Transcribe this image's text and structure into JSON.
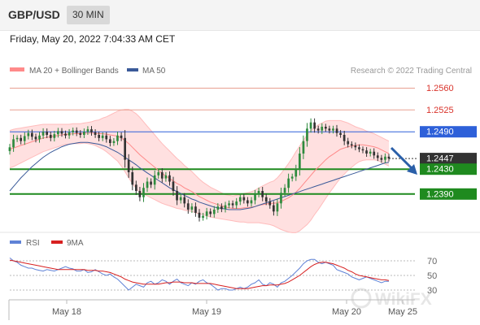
{
  "header": {
    "pair": "GBP/USD",
    "timeframe": "30 MIN",
    "datetime": "Friday, May 20, 2022 7:04:33 AM CET"
  },
  "legend": {
    "ma20": "MA 20 + Bollinger Bands",
    "ma50": "MA 50",
    "credit": "Research © 2022 Trading Central"
  },
  "rsi_legend": {
    "rsi": "RSI",
    "ma": "9MA"
  },
  "watermark": "WikiFX",
  "colors": {
    "up": "#2e8b3e",
    "down": "#333333",
    "bands": "#ff8a8a",
    "ma50": "#3a5a99",
    "rsi": "#5f82d6",
    "rsi_ma": "#d72020",
    "resistance": "#e8a090",
    "pivot_line": "#2e60d9",
    "support": "#1f8a1f",
    "current": "#333333"
  },
  "chart_data": [
    {
      "type": "candlestick",
      "title": "GBP/USD",
      "x_labels": [
        "May 18",
        "May 19",
        "May 20",
        "May 25"
      ],
      "ylim": [
        1.2335,
        1.2575
      ],
      "levels": [
        {
          "label": "1.2560",
          "value": 1.256,
          "kind": "resistance"
        },
        {
          "label": "1.2525",
          "value": 1.2525,
          "kind": "resistance"
        },
        {
          "label": "1.2490",
          "value": 1.249,
          "kind": "pivot"
        },
        {
          "label": "1.2447",
          "value": 1.2447,
          "kind": "current"
        },
        {
          "label": "1.2430",
          "value": 1.243,
          "kind": "support"
        },
        {
          "label": "1.2390",
          "value": 1.239,
          "kind": "support"
        }
      ],
      "close": [
        1.2465,
        1.2478,
        1.248,
        1.2475,
        1.2483,
        1.2488,
        1.2482,
        1.2478,
        1.2484,
        1.249,
        1.2485,
        1.248,
        1.2486,
        1.2491,
        1.2487,
        1.2484,
        1.2489,
        1.2492,
        1.2488,
        1.2485,
        1.249,
        1.2494,
        1.2489,
        1.2485,
        1.248,
        1.2484,
        1.2478,
        1.2472,
        1.2475,
        1.2484,
        1.248,
        1.2445,
        1.2425,
        1.2405,
        1.2395,
        1.2385,
        1.24,
        1.241,
        1.2405,
        1.242,
        1.2425,
        1.2415,
        1.242,
        1.241,
        1.2395,
        1.238,
        1.2385,
        1.2375,
        1.2365,
        1.237,
        1.236,
        1.2352,
        1.2355,
        1.2362,
        1.2358,
        1.2365,
        1.237,
        1.2366,
        1.2372,
        1.2375,
        1.2372,
        1.2378,
        1.2385,
        1.238,
        1.2375,
        1.238,
        1.239,
        1.2395,
        1.2385,
        1.2378,
        1.2372,
        1.2362,
        1.2375,
        1.2392,
        1.24,
        1.2415,
        1.2418,
        1.243,
        1.2455,
        1.2475,
        1.2495,
        1.2505,
        1.2495,
        1.2492,
        1.2498,
        1.2495,
        1.2492,
        1.2495,
        1.2488,
        1.2485,
        1.2475,
        1.247,
        1.2468,
        1.2465,
        1.2462,
        1.246,
        1.2455,
        1.2458,
        1.2452,
        1.2448,
        1.2445,
        1.245,
        1.2447
      ],
      "ma20": [
        1.2462,
        1.2464,
        1.2466,
        1.2468,
        1.247,
        1.2472,
        1.2474,
        1.2476,
        1.2478,
        1.248,
        1.2481,
        1.2482,
        1.2483,
        1.2484,
        1.2485,
        1.2486,
        1.2486,
        1.2487,
        1.2487,
        1.2487,
        1.2488,
        1.2488,
        1.2488,
        1.2488,
        1.2487,
        1.2487,
        1.2486,
        1.2485,
        1.2484,
        1.2483,
        1.248,
        1.2476,
        1.2471,
        1.2465,
        1.2459,
        1.2453,
        1.2448,
        1.2443,
        1.2438,
        1.2433,
        1.2428,
        1.2423,
        1.2419,
        1.2415,
        1.2411,
        1.2407,
        1.2404,
        1.24,
        1.2397,
        1.2394,
        1.239,
        1.2386,
        1.2383,
        1.238,
        1.2377,
        1.2375,
        1.2373,
        1.2371,
        1.2369,
        1.2368,
        1.2367,
        1.2367,
        1.2367,
        1.2368,
        1.2368,
        1.2369,
        1.237,
        1.2372,
        1.2373,
        1.2374,
        1.2375,
        1.2375,
        1.2376,
        1.2378,
        1.2381,
        1.2384,
        1.2388,
        1.2393,
        1.2399,
        1.2406,
        1.2413,
        1.242,
        1.2427,
        1.2433,
        1.2439,
        1.2445,
        1.245,
        1.2454,
        1.2458,
        1.2462,
        1.2464,
        1.2466,
        1.2467,
        1.2468,
        1.2469,
        1.2469,
        1.2468,
        1.2467,
        1.2466,
        1.2464,
        1.2461,
        1.2458,
        1.2455
      ],
      "bollinger_width": [
        0.003,
        0.003,
        0.0029,
        0.0028,
        0.0027,
        0.0026,
        0.0025,
        0.0024,
        0.0023,
        0.0022,
        0.0021,
        0.002,
        0.0019,
        0.0018,
        0.0017,
        0.0016,
        0.0016,
        0.0016,
        0.0016,
        0.0016,
        0.0016,
        0.0017,
        0.0018,
        0.002,
        0.0022,
        0.0025,
        0.0028,
        0.0032,
        0.0036,
        0.004,
        0.0045,
        0.005,
        0.0055,
        0.0058,
        0.006,
        0.006,
        0.0058,
        0.0056,
        0.0054,
        0.0052,
        0.005,
        0.0048,
        0.0046,
        0.0044,
        0.0042,
        0.004,
        0.0038,
        0.0036,
        0.0034,
        0.0032,
        0.003,
        0.0028,
        0.0026,
        0.0025,
        0.0024,
        0.0023,
        0.0022,
        0.0021,
        0.002,
        0.002,
        0.002,
        0.0021,
        0.0022,
        0.0023,
        0.0024,
        0.0025,
        0.0026,
        0.0028,
        0.003,
        0.0032,
        0.0034,
        0.0036,
        0.004,
        0.0045,
        0.005,
        0.0055,
        0.006,
        0.0065,
        0.0068,
        0.007,
        0.0072,
        0.0072,
        0.007,
        0.0068,
        0.0065,
        0.0062,
        0.0058,
        0.0054,
        0.005,
        0.0046,
        0.0042,
        0.0038,
        0.0034,
        0.003,
        0.0027,
        0.0025,
        0.0023,
        0.0022,
        0.0021,
        0.002,
        0.002,
        0.002,
        0.002
      ],
      "ma50": [
        1.2395,
        1.2402,
        1.2409,
        1.2416,
        1.2422,
        1.2428,
        1.2434,
        1.2439,
        1.2444,
        1.2449,
        1.2453,
        1.2457,
        1.246,
        1.2463,
        1.2466,
        1.2468,
        1.247,
        1.2471,
        1.2472,
        1.2473,
        1.2473,
        1.2473,
        1.2472,
        1.2471,
        1.247,
        1.2468,
        1.2466,
        1.2463,
        1.246,
        1.2457,
        1.2453,
        1.2449,
        1.2445,
        1.2441,
        1.2437,
        1.2432,
        1.2428,
        1.2424,
        1.242,
        1.2416,
        1.2412,
        1.2408,
        1.2404,
        1.24,
        1.2397,
        1.2394,
        1.2391,
        1.2388,
        1.2385,
        1.2382,
        1.238,
        1.2377,
        1.2375,
        1.2373,
        1.2371,
        1.2369,
        1.2368,
        1.2367,
        1.2366,
        1.2365,
        1.2365,
        1.2365,
        1.2365,
        1.2366,
        1.2367,
        1.2368,
        1.237,
        1.2372,
        1.2374,
        1.2376,
        1.2378,
        1.238,
        1.2382,
        1.2384,
        1.2386,
        1.2388,
        1.239,
        1.2392,
        1.2394,
        1.2396,
        1.2398,
        1.24,
        1.2402,
        1.2404,
        1.2406,
        1.2408,
        1.241,
        1.2412,
        1.2414,
        1.2416,
        1.2418,
        1.242,
        1.2422,
        1.2424,
        1.2426,
        1.2428,
        1.243,
        1.2432,
        1.2434,
        1.2436,
        1.2438,
        1.244,
        1.2441
      ]
    },
    {
      "type": "line",
      "title": "RSI",
      "ylim": [
        20,
        80
      ],
      "y_ticks": [
        "70",
        "50",
        "30"
      ],
      "series": [
        {
          "name": "RSI",
          "values": [
            74,
            70,
            68,
            64,
            62,
            60,
            60,
            58,
            57,
            56,
            58,
            57,
            56,
            58,
            60,
            62,
            60,
            59,
            56,
            56,
            58,
            54,
            55,
            58,
            55,
            52,
            50,
            52,
            48,
            45,
            40,
            35,
            30,
            34,
            38,
            36,
            34,
            40,
            42,
            38,
            40,
            44,
            42,
            38,
            42,
            45,
            40,
            38,
            36,
            40,
            38,
            42,
            44,
            40,
            38,
            34,
            30,
            32,
            32,
            30,
            30,
            32,
            34,
            32,
            34,
            38,
            40,
            44,
            38,
            36,
            40,
            38,
            34,
            40,
            42,
            46,
            50,
            55,
            60,
            66,
            70,
            72,
            72,
            68,
            66,
            68,
            66,
            64,
            58,
            56,
            54,
            52,
            48,
            46,
            44,
            46,
            48,
            46,
            44,
            42,
            40,
            42,
            42
          ]
        },
        {
          "name": "9MA",
          "values": [
            71,
            70,
            69,
            68,
            67,
            66,
            65,
            64,
            63,
            62,
            61,
            60,
            59,
            58,
            58,
            58,
            58,
            58,
            58,
            58,
            58,
            57,
            57,
            57,
            56,
            56,
            55,
            54,
            52,
            50,
            48,
            45,
            43,
            41,
            40,
            39,
            38,
            38,
            38,
            38,
            38,
            39,
            40,
            40,
            41,
            41,
            41,
            40,
            40,
            40,
            39,
            39,
            39,
            39,
            39,
            38,
            37,
            36,
            35,
            34,
            33,
            32,
            32,
            32,
            32,
            33,
            34,
            35,
            36,
            36,
            37,
            37,
            37,
            38,
            39,
            41,
            44,
            47,
            50,
            54,
            58,
            62,
            65,
            67,
            68,
            68,
            67,
            66,
            64,
            62,
            60,
            57,
            55,
            52,
            50,
            49,
            48,
            47,
            46,
            45,
            44,
            44,
            43
          ]
        }
      ]
    }
  ]
}
